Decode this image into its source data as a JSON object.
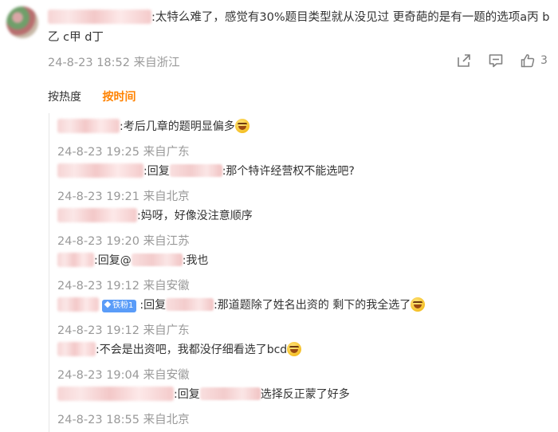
{
  "main_comment": {
    "text": ":太特么难了，感觉有30%题目类型就从没见过 更奇葩的是有一题的选项a丙 b乙 c甲 d丁",
    "date": "24-8-23 18:52",
    "location": "来自浙江",
    "like_count": "3"
  },
  "sort_tabs": {
    "hot": "按热度",
    "time": "按时间"
  },
  "icons": {
    "share": "share-icon",
    "comment": "comment-icon",
    "like": "like-icon",
    "emoji": "laugh-cry-emoji"
  },
  "replies": [
    {
      "text": ":考后几章的题明显偏多",
      "meta": "24-8-23 19:25 来自广东"
    },
    {
      "prefix": ":回复",
      "text": ":那个特许经营权不能选吧?",
      "meta": "24-8-23 19:21 来自北京"
    },
    {
      "text": ":妈呀，好像没注意顺序",
      "meta": "24-8-23 19:20 来自江苏"
    },
    {
      "prefix": ":回复@",
      "text": ":我也",
      "meta": "24-8-23 19:12 来自安徽"
    },
    {
      "badge": "铁粉1",
      "prefix": ":回复",
      "text": ":那道题除了姓名出资的 剩下的我全选了",
      "meta": "24-8-23 19:12 来自广东"
    },
    {
      "text": ":不会是出资吧，我都没仔细看选了bcd",
      "meta": "24-8-23 19:04 来自安徽"
    },
    {
      "prefix": ":回复",
      "text": "选择反正蒙了好多",
      "meta": "24-8-23 18:55 来自北京"
    }
  ],
  "colors": {
    "accent": "#ff8200",
    "meta_gray": "#999999",
    "badge_blue": "#5a9cf8"
  }
}
